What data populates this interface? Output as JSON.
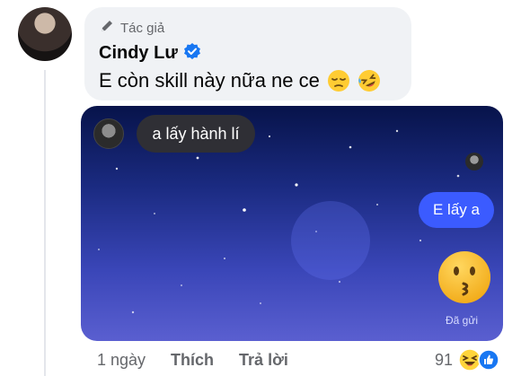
{
  "comment": {
    "author_badge": "Tác giả",
    "author_name": "Cindy Lư",
    "text": "E còn skill này nữa ne ce",
    "emojis": [
      "pensive-face-icon",
      "rolling-laughing-face-icon"
    ]
  },
  "media": {
    "left_message": "a lấy hành lí",
    "right_message": "E lấy a",
    "sent_status": "Đã gửi",
    "reaction_emoji": "kissing-face-icon",
    "colors": {
      "sky_top": "#07134a",
      "sky_bottom": "#5a5fd0",
      "sent_bubble": "#3b5bff",
      "received_bubble": "#2f2f35"
    }
  },
  "actions": {
    "time": "1 ngày",
    "like_label": "Thích",
    "reply_label": "Trả lời"
  },
  "reactions": {
    "count": "91",
    "icons": [
      "haha-reaction-icon",
      "like-reaction-icon"
    ]
  },
  "colors": {
    "bubble_bg": "#f0f2f5",
    "secondary_text": "#65676b",
    "verified_blue": "#1877f2"
  }
}
